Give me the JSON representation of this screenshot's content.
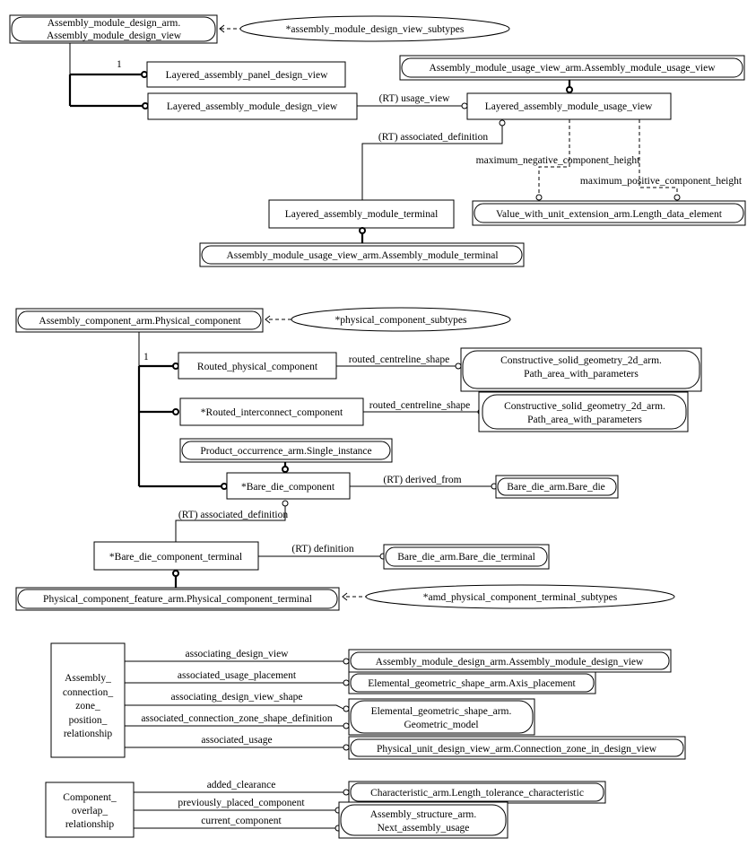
{
  "nodes": {
    "amdv": [
      "Assembly_module_design_arm.",
      "Assembly_module_design_view"
    ],
    "amdv_subtypes": "*assembly_module_design_view_subtypes",
    "lapdv": "Layered_assembly_panel_design_view",
    "lamdv": "Layered_assembly_module_design_view",
    "amuv": "Assembly_module_usage_view_arm.Assembly_module_usage_view",
    "lamuv": "Layered_assembly_module_usage_view",
    "lamt": "Layered_assembly_module_terminal",
    "amt": "Assembly_module_usage_view_arm.Assembly_module_terminal",
    "lde": "Value_with_unit_extension_arm.Length_data_element",
    "pc": "Assembly_component_arm.Physical_component",
    "pc_subtypes": "*physical_component_subtypes",
    "rpc": "Routed_physical_component",
    "pawp1": [
      "Constructive_solid_geometry_2d_arm.",
      "Path_area_with_parameters"
    ],
    "ric": "*Routed_interconnect_component",
    "pawp2": [
      "Constructive_solid_geometry_2d_arm.",
      "Path_area_with_parameters"
    ],
    "si": "Product_occurrence_arm.Single_instance",
    "bdc": "*Bare_die_component",
    "bd": "Bare_die_arm.Bare_die",
    "bdct": "*Bare_die_component_terminal",
    "bdt": "Bare_die_arm.Bare_die_terminal",
    "pct": "Physical_component_feature_arm.Physical_component_terminal",
    "pct_subtypes": "*amd_physical_component_terminal_subtypes",
    "aczpr": [
      "Assembly_",
      "connection_",
      "zone_",
      "position_",
      "relationship"
    ],
    "amdv2": "Assembly_module_design_arm.Assembly_module_design_view",
    "ap": "Elemental_geometric_shape_arm.Axis_placement",
    "gm": [
      "Elemental_geometric_shape_arm.",
      "Geometric_model"
    ],
    "czdv": "Physical_unit_design_view_arm.Connection_zone_in_design_view",
    "cor": [
      "Component_",
      "overlap_",
      "relationship"
    ],
    "ltc": "Characteristic_arm.Length_tolerance_characteristic",
    "nau": [
      "Assembly_structure_arm.",
      "Next_assembly_usage"
    ]
  },
  "edges": {
    "cardinality_1a": "1",
    "usage_view": "(RT) usage_view",
    "assoc_def1": "(RT) associated_definition",
    "max_neg": "maximum_negative_component_height",
    "max_pos": "maximum_positive_component_height",
    "cardinality_1b": "1",
    "rcs1": "routed_centreline_shape",
    "rcs2": "routed_centreline_shape",
    "derived_from": "(RT) derived_from",
    "assoc_def2": "(RT) associated_definition",
    "definition": "(RT) definition",
    "adv": "associating_design_view",
    "aup": "associated_usage_placement",
    "advs": "associating_design_view_shape",
    "aczsd": "associated_connection_zone_shape_definition",
    "au": "associated_usage",
    "ac": "added_clearance",
    "ppc": "previously_placed_component",
    "cc": "current_component"
  }
}
